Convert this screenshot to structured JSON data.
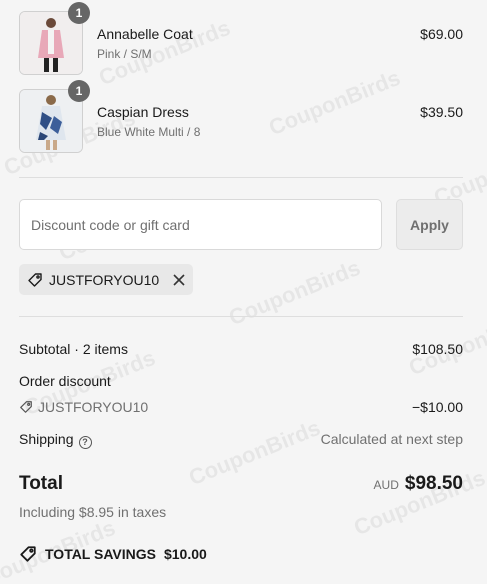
{
  "items": [
    {
      "name": "Annabelle Coat",
      "variant": "Pink / S/M",
      "price": "$69.00",
      "qty": "1"
    },
    {
      "name": "Caspian Dress",
      "variant": "Blue White Multi / 8",
      "price": "$39.50",
      "qty": "1"
    }
  ],
  "discount": {
    "placeholder": "Discount code or gift card",
    "apply_label": "Apply",
    "applied_code": "JUSTFORYOU10"
  },
  "summary": {
    "subtotal_label": "Subtotal · 2 items",
    "subtotal_value": "$108.50",
    "order_discount_label": "Order discount",
    "order_discount_code": "JUSTFORYOU10",
    "order_discount_value": "−$10.00",
    "shipping_label": "Shipping",
    "shipping_help": "?",
    "shipping_value": "Calculated at next step",
    "total_label": "Total",
    "currency": "AUD",
    "total_value": "$98.50",
    "taxes_note": "Including $8.95 in taxes",
    "savings_label": "TOTAL SAVINGS",
    "savings_value": "$10.00"
  },
  "watermark": "CouponBirds",
  "colors": {
    "background": "#f5f5f5",
    "badge": "#666666",
    "muted_text": "#707070",
    "chip": "#e8e8e8"
  }
}
